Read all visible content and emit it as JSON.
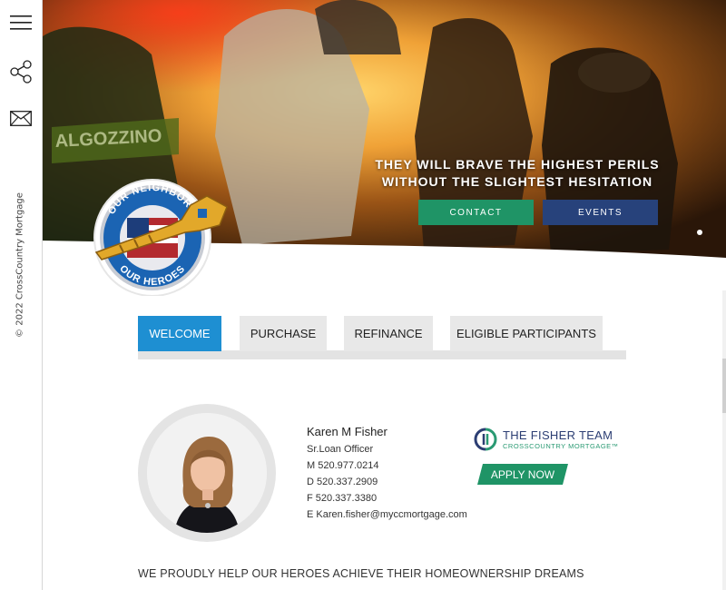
{
  "sidebar": {
    "menu_icon": "hamburger-menu-icon",
    "share_icon": "share-icon",
    "mail_icon": "envelope-icon",
    "copyright": "© 2022 CrossCountry Mortgage"
  },
  "hero": {
    "headline_line1": "THEY WILL BRAVE THE HIGHEST PERILS",
    "headline_line2": "WITHOUT THE SLIGHTEST HESITATION",
    "contact_label": "CONTACT",
    "events_label": "EVENTS",
    "helmet_text": "ALGOZZINO",
    "badge_top": "OUR NEIGHBORS",
    "badge_bottom": "OUR HEROES"
  },
  "tabs": [
    {
      "label": "WELCOME",
      "active": true
    },
    {
      "label": "PURCHASE",
      "active": false
    },
    {
      "label": "REFINANCE",
      "active": false
    },
    {
      "label": "ELIGIBLE PARTICIPANTS",
      "active": false
    }
  ],
  "profile": {
    "name": "Karen M Fisher",
    "title": "Sr.Loan Officer",
    "mobile": "M 520.977.0214",
    "direct": "D 520.337.2909",
    "fax": "F 520.337.3380",
    "email": "E Karen.fisher@myccmortgage.com"
  },
  "team": {
    "title": "THE FISHER TEAM",
    "subtitle": "CROSSCOUNTRY MORTGAGE™",
    "apply_label": "APPLY NOW"
  },
  "tagline": "WE PROUDLY HELP OUR HEROES ACHIEVE THEIR HOMEOWNERSHIP DREAMS",
  "colors": {
    "active_tab": "#1e8fd2",
    "green": "#1f9466",
    "navy": "#27427b"
  }
}
